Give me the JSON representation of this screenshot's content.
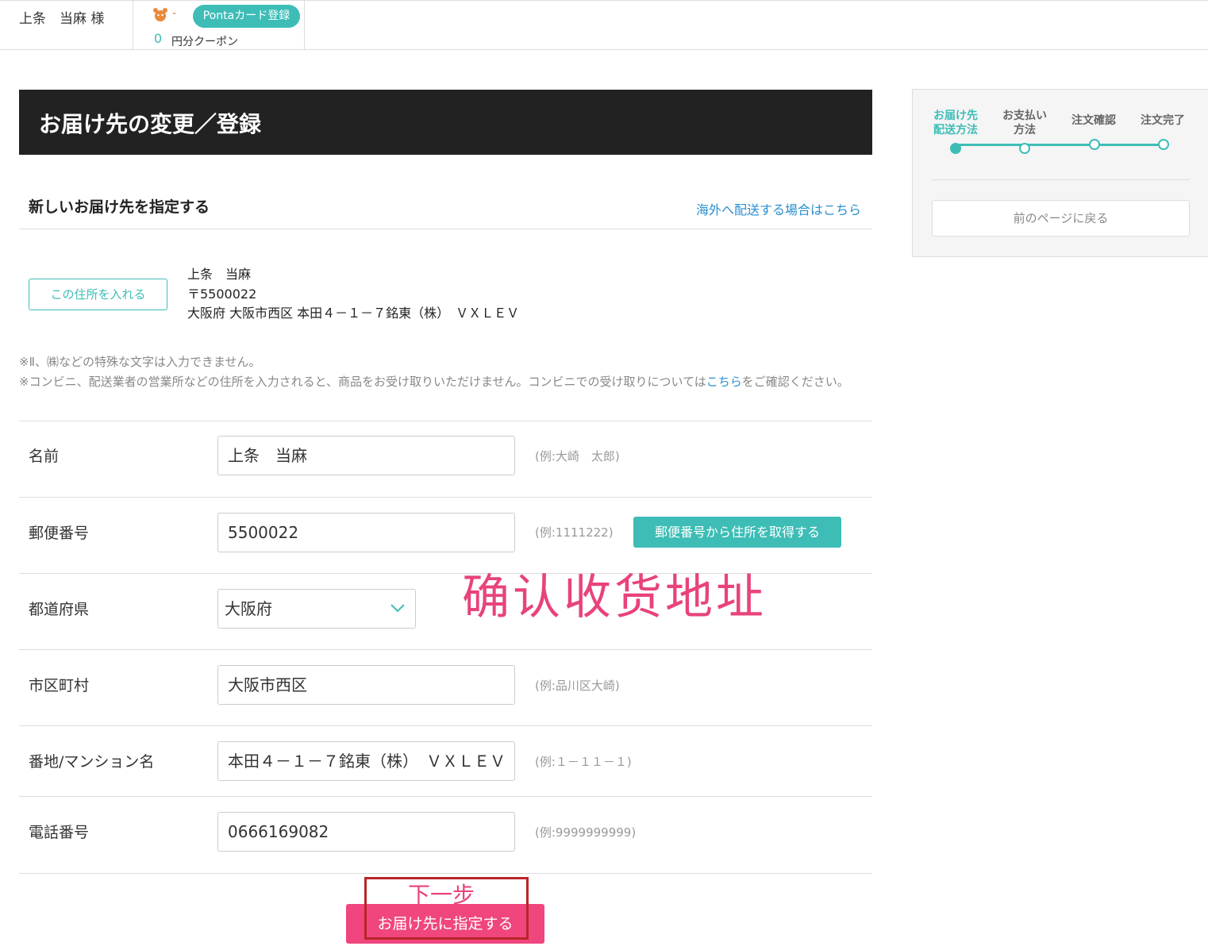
{
  "topbar": {
    "user_name": "上条　当麻 様",
    "ponta_dash": "-",
    "ponta_button": "Pontaカード登録",
    "coupon_count": "0",
    "coupon_label": "円分クーポン"
  },
  "header": {
    "title": "お届け先の変更／登録"
  },
  "section": {
    "title": "新しいお届け先を指定する",
    "overseas_link": "海外へ配送する場合はこちら"
  },
  "saved_address": {
    "button": "この住所を入れる",
    "name": "上条　当麻",
    "postal": "〒5500022",
    "address": "大阪府 大阪市西区 本田４－１－７銘東（株）　ＶＸＬＥＶ"
  },
  "notes": {
    "line1": "※Ⅱ、㈱などの特殊な文字は入力できません。",
    "line2_before": "※コンビニ、配送業者の営業所などの住所を入力されると、商品をお受け取りいただけません。コンビニでの受け取りについては",
    "line2_link": "こちら",
    "line2_after": "をご確認ください。"
  },
  "form": {
    "name": {
      "label": "名前",
      "value": "上条　当麻",
      "example": "(例:大崎　太郎)"
    },
    "postal": {
      "label": "郵便番号",
      "value": "5500022",
      "example": "(例:1111222)",
      "lookup_button": "郵便番号から住所を取得する"
    },
    "prefecture": {
      "label": "都道府県",
      "value": "大阪府"
    },
    "city": {
      "label": "市区町村",
      "value": "大阪市西区",
      "example": "(例:品川区大崎)"
    },
    "street": {
      "label": "番地/マンション名",
      "value": "本田４－１－７銘東（株）　ＶＸＬＥＶ",
      "example": "(例:１－１１－１)"
    },
    "phone": {
      "label": "電話番号",
      "value": "0666169082",
      "example": "(例:9999999999)"
    }
  },
  "overlay": {
    "confirm_text": "确认收货地址",
    "next_step": "下一步"
  },
  "submit": {
    "label": "お届け先に指定する"
  },
  "sidebar": {
    "steps": [
      {
        "label_line1": "お届け先",
        "label_line2": "配送方法",
        "active": true
      },
      {
        "label_line1": "お支払い",
        "label_line2": "方法",
        "active": false
      },
      {
        "label_line1": "注文確認",
        "label_line2": "",
        "active": false
      },
      {
        "label_line1": "注文完了",
        "label_line2": "",
        "active": false
      }
    ],
    "back_button": "前のページに戻る"
  },
  "colors": {
    "accent": "#3dbdb6",
    "submit": "#f0467d",
    "link": "#2a8fcf",
    "header_bg": "#222222",
    "overlay_text": "#e8437a",
    "highlight_box": "#b8252a"
  }
}
